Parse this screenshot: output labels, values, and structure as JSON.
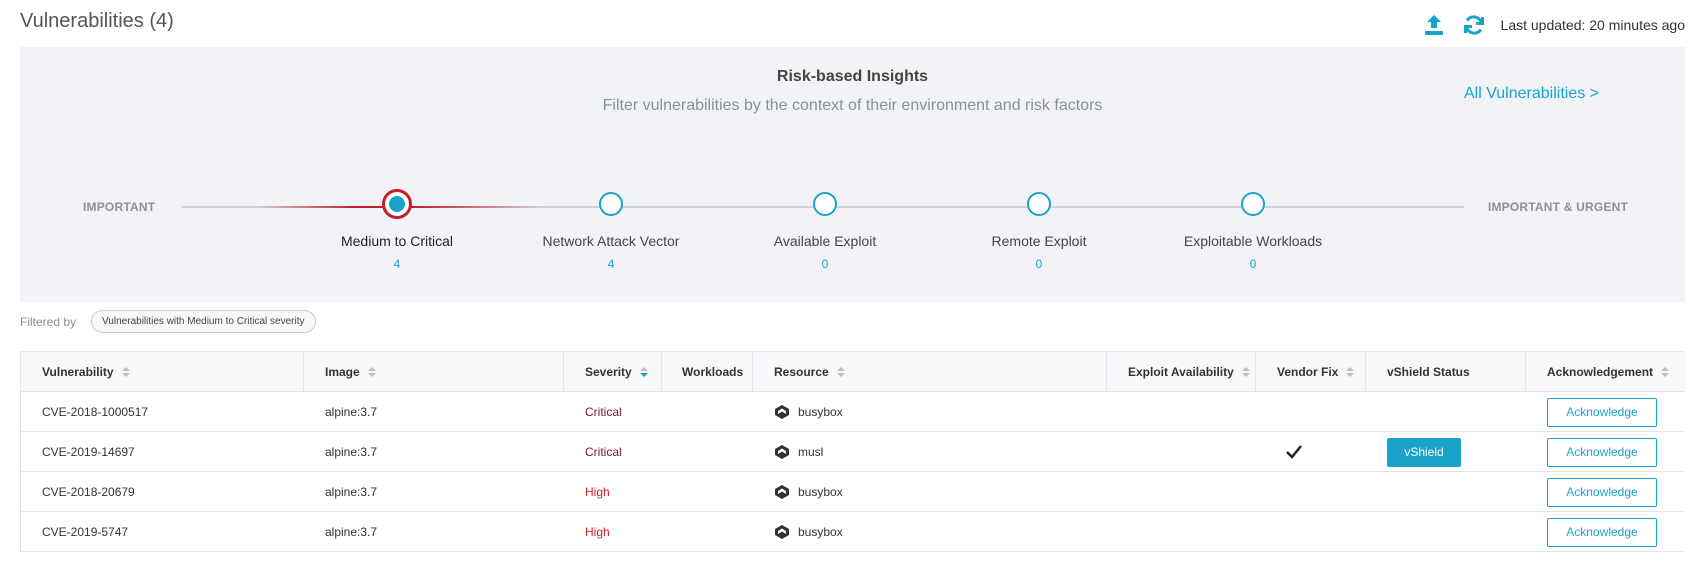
{
  "header": {
    "title": "Vulnerabilities (4)",
    "last_updated": "Last updated: 20 minutes ago"
  },
  "insights": {
    "title": "Risk-based Insights",
    "subtitle": "Filter vulnerabilities by the context of their environment and risk factors",
    "all_link": "All Vulnerabilities >",
    "left_label": "IMPORTANT",
    "right_label": "IMPORTANT & URGENT",
    "steps": [
      {
        "label": "Medium to Critical",
        "count": "4",
        "active": true
      },
      {
        "label": "Network Attack Vector",
        "count": "4",
        "active": false
      },
      {
        "label": "Available Exploit",
        "count": "0",
        "active": false
      },
      {
        "label": "Remote Exploit",
        "count": "0",
        "active": false
      },
      {
        "label": "Exploitable Workloads",
        "count": "0",
        "active": false
      }
    ]
  },
  "filter": {
    "label": "Filtered by",
    "chip": "Vulnerabilities with Medium to Critical severity"
  },
  "table": {
    "columns": [
      "Vulnerability",
      "Image",
      "Severity",
      "Workloads",
      "Resource",
      "Exploit Availability",
      "Vendor Fix",
      "vShield Status",
      "Acknowledgement"
    ],
    "rows": [
      {
        "vulnerability": "CVE-2018-1000517",
        "image": "alpine:3.7",
        "severity": "Critical",
        "resource": "busybox",
        "vendor_fix": false,
        "vshield": "",
        "ack": "Acknowledge"
      },
      {
        "vulnerability": "CVE-2019-14697",
        "image": "alpine:3.7",
        "severity": "Critical",
        "resource": "musl",
        "vendor_fix": true,
        "vshield": "vShield",
        "ack": "Acknowledge"
      },
      {
        "vulnerability": "CVE-2018-20679",
        "image": "alpine:3.7",
        "severity": "High",
        "resource": "busybox",
        "vendor_fix": false,
        "vshield": "",
        "ack": "Acknowledge"
      },
      {
        "vulnerability": "CVE-2019-5747",
        "image": "alpine:3.7",
        "severity": "High",
        "resource": "busybox",
        "vendor_fix": false,
        "vshield": "",
        "ack": "Acknowledge"
      }
    ]
  },
  "colors": {
    "accent": "#1aa3c9",
    "active_ring": "#c41e28",
    "critical": "#8a1538",
    "high": "#d4202c"
  },
  "icons": {
    "export": "upload-icon",
    "refresh": "refresh-icon",
    "resource": "package-icon",
    "vendor_fix": "checkmark-icon"
  }
}
